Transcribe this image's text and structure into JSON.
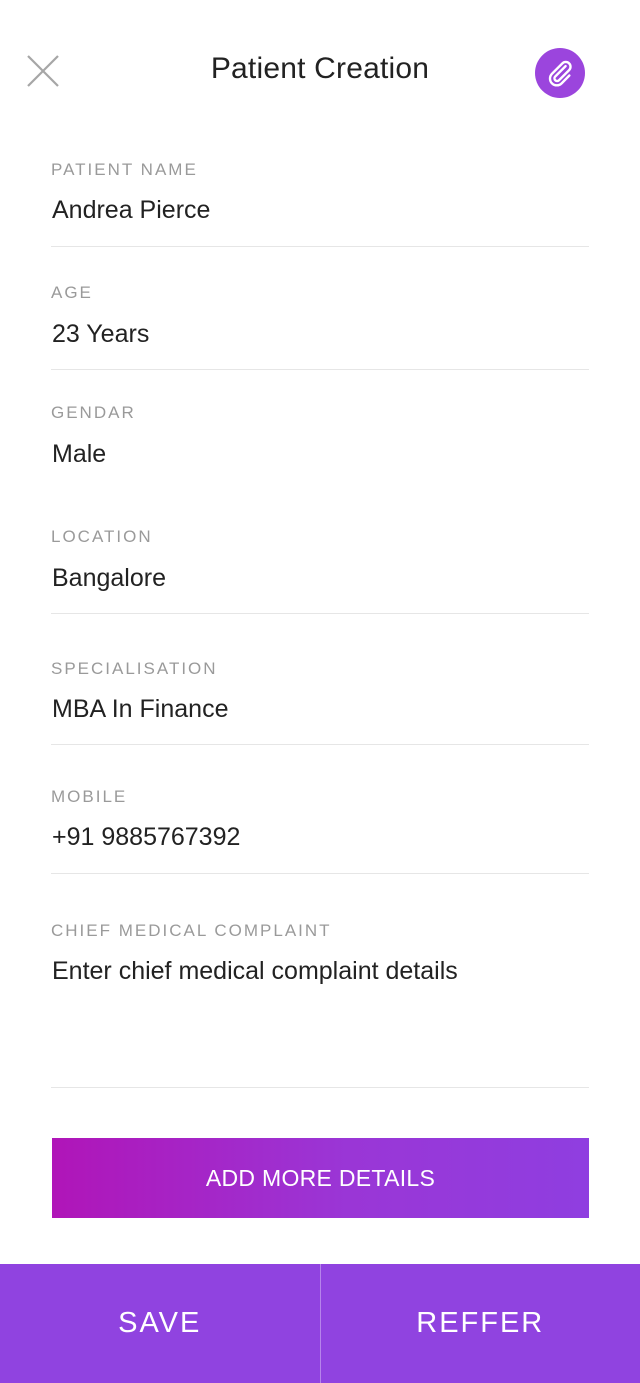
{
  "header": {
    "title": "Patient Creation",
    "close_icon": "close-icon",
    "attach_icon": "paperclip-icon",
    "accent_color": "#9b45dd"
  },
  "form": {
    "patient_name": {
      "label": "PATIENT NAME",
      "value": "Andrea Pierce"
    },
    "age": {
      "label": "AGE",
      "value": "23 Years"
    },
    "gender": {
      "label": "GENDAR",
      "value": "Male"
    },
    "location": {
      "label": "LOCATION",
      "value": "Bangalore"
    },
    "specialisation": {
      "label": "SPECIALISATION",
      "value": "MBA In Finance"
    },
    "mobile": {
      "label": "MOBILE",
      "value": "+91 9885767392"
    },
    "complaint": {
      "label": "CHIEF MEDICAL COMPLAINT",
      "placeholder": "Enter chief medical complaint details"
    }
  },
  "actions": {
    "add_more_label": "ADD MORE DETAILS",
    "save_label": "SAVE",
    "refer_label": "REFFER"
  }
}
